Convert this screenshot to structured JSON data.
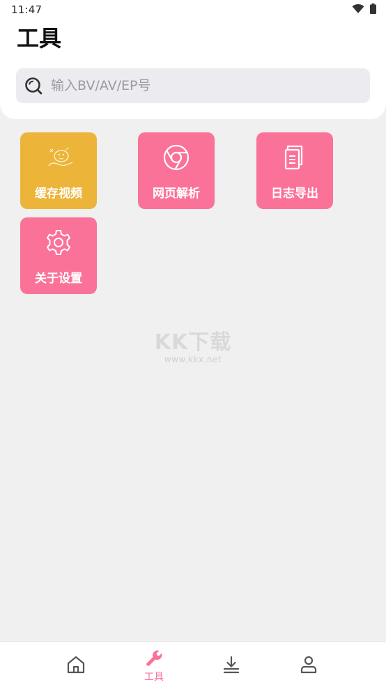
{
  "status_bar": {
    "time": "11:47"
  },
  "header": {
    "title": "工具"
  },
  "search": {
    "placeholder": "输入BV/AV/EP号"
  },
  "tools": [
    {
      "label": "缓存视频",
      "icon": "cached-video-icon",
      "color": "#edb43a"
    },
    {
      "label": "网页解析",
      "icon": "chrome-icon",
      "color": "#fb7299"
    },
    {
      "label": "日志导出",
      "icon": "document-copy-icon",
      "color": "#fb7299"
    },
    {
      "label": "关于设置",
      "icon": "gear-icon",
      "color": "#fb7299"
    }
  ],
  "watermark": {
    "logo": "KK下载",
    "url": "www.kkx.net"
  },
  "bottom_nav": {
    "items": [
      {
        "name": "home",
        "icon": "home-icon",
        "label": ""
      },
      {
        "name": "tools",
        "icon": "wrench-icon",
        "label": "工具",
        "active": true
      },
      {
        "name": "downloads",
        "icon": "download-icon",
        "label": ""
      },
      {
        "name": "profile",
        "icon": "person-icon",
        "label": ""
      }
    ]
  },
  "colors": {
    "accent": "#fb7299",
    "cache_tile": "#edb43a",
    "background": "#f0f0f0"
  }
}
